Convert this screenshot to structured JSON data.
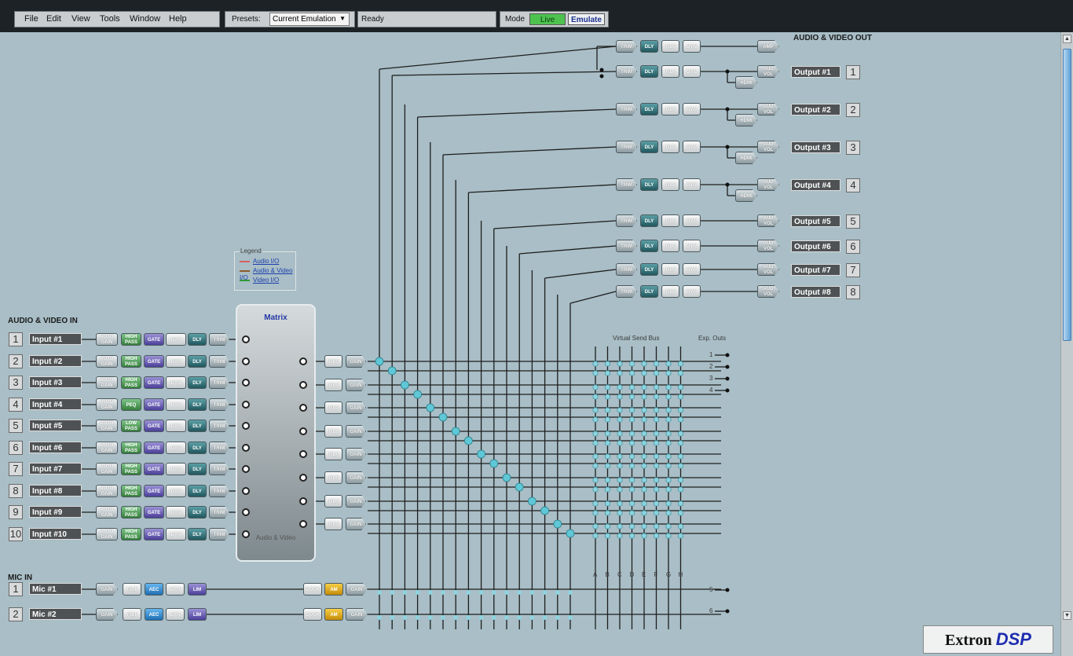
{
  "menu": [
    "File",
    "Edit",
    "View",
    "Tools",
    "Window",
    "Help"
  ],
  "presets": {
    "label": "Presets:",
    "value": "Current Emulation"
  },
  "status": "Ready",
  "mode": {
    "label": "Mode",
    "live": "Live",
    "emulate": "Emulate"
  },
  "sections": {
    "av_in": "AUDIO & VIDEO IN",
    "av_out": "AUDIO & VIDEO OUT",
    "mic_in": "MIC IN"
  },
  "legend": {
    "title": "Legend",
    "items": [
      "Audio I/O",
      "Audio & Video I/O",
      "Video I/O"
    ],
    "colors": [
      "#d86060",
      "#8a5a2a",
      "#2f9a3c"
    ]
  },
  "matrix": {
    "title": "Matrix",
    "subtitle": "Audio & Video"
  },
  "inputs": [
    {
      "num": "1",
      "name": "Input #1",
      "chain": [
        "AUTO GAIN",
        "HIGH PASS",
        "GATE",
        "DYN",
        "DLY",
        "TRIM"
      ]
    },
    {
      "num": "2",
      "name": "Input #2",
      "chain": [
        "AUTO GAIN",
        "HIGH PASS",
        "GATE",
        "DYN",
        "DLY",
        "TRIM"
      ]
    },
    {
      "num": "3",
      "name": "Input #3",
      "chain": [
        "AUTO GAIN",
        "HIGH PASS",
        "GATE",
        "DYN",
        "DLY",
        "TRIM"
      ]
    },
    {
      "num": "4",
      "name": "Input #4",
      "chain": [
        "AUTO GAIN",
        "PEQ",
        "GATE",
        "DYN",
        "DLY",
        "TRIM"
      ]
    },
    {
      "num": "5",
      "name": "Input #5",
      "chain": [
        "AUTO GAIN",
        "LOW PASS",
        "GATE",
        "DYN",
        "DLY",
        "TRIM"
      ]
    },
    {
      "num": "6",
      "name": "Input #6",
      "chain": [
        "AUTO GAIN",
        "HIGH PASS",
        "GATE",
        "DYN",
        "DLY",
        "TRIM"
      ]
    },
    {
      "num": "7",
      "name": "Input #7",
      "chain": [
        "AUTO GAIN",
        "HIGH PASS",
        "GATE",
        "DYN",
        "DLY",
        "TRIM"
      ]
    },
    {
      "num": "8",
      "name": "Input #8",
      "chain": [
        "AUTO GAIN",
        "HIGH PASS",
        "GATE",
        "DYN",
        "DLY",
        "TRIM"
      ]
    },
    {
      "num": "9",
      "name": "Input #9",
      "chain": [
        "AUTO GAIN",
        "HIGH PASS",
        "GATE",
        "DYN",
        "DLY",
        "TRIM"
      ]
    },
    {
      "num": "10",
      "name": "Input #10",
      "chain": [
        "AUTO GAIN",
        "HIGH PASS",
        "GATE",
        "DYN",
        "DLY",
        "TRIM"
      ]
    }
  ],
  "mics": [
    {
      "num": "1",
      "name": "Mic #1",
      "chain": [
        "GAIN",
        "FILT",
        "AEC",
        "DYN",
        "LIM"
      ],
      "post": [
        "DUCK",
        "AM",
        "GAIN"
      ]
    },
    {
      "num": "2",
      "name": "Mic #2",
      "chain": [
        "GAIN",
        "FILT",
        "AEC",
        "DYN",
        "LIM"
      ],
      "post": [
        "DUCK",
        "AM",
        "GAIN"
      ]
    }
  ],
  "matrix_out_blocks": [
    "FILT",
    "GAIN"
  ],
  "outputs": [
    {
      "num": "",
      "name": "",
      "chain": [
        "TRIM",
        "DLY",
        "FILT",
        "DYN"
      ],
      "end": "AMP"
    },
    {
      "num": "1",
      "name": "Output #1",
      "chain": [
        "TRIM",
        "DLY",
        "FILT",
        "DYN"
      ],
      "end": "AUD VOL",
      "hdmi": "HDMI"
    },
    {
      "num": "2",
      "name": "Output #2",
      "chain": [
        "TRIM",
        "DLY",
        "FILT",
        "DYN"
      ],
      "end": "AUD VOL",
      "hdmi": "HDMI"
    },
    {
      "num": "3",
      "name": "Output #3",
      "chain": [
        "TRIM",
        "DLY",
        "FILT",
        "DYN"
      ],
      "end": "AUD VOL",
      "hdmi": "HDMI"
    },
    {
      "num": "4",
      "name": "Output #4",
      "chain": [
        "TRIM",
        "DLY",
        "FILT",
        "DYN"
      ],
      "end": "AUD VOL",
      "hdmi": "HDMI"
    },
    {
      "num": "5",
      "name": "Output #5",
      "chain": [
        "TRIM",
        "DLY",
        "FILT",
        "DYN"
      ],
      "end": "AUD VOL"
    },
    {
      "num": "6",
      "name": "Output #6",
      "chain": [
        "TRIM",
        "DLY",
        "FILT",
        "DYN"
      ],
      "end": "AUD VOL"
    },
    {
      "num": "7",
      "name": "Output #7",
      "chain": [
        "TRIM",
        "DLY",
        "FILT",
        "DYN"
      ],
      "end": "AUD VOL"
    },
    {
      "num": "8",
      "name": "Output #8",
      "chain": [
        "TRIM",
        "DLY",
        "FILT",
        "DYN"
      ],
      "end": "AUD VOL"
    }
  ],
  "virtual_send_bus": {
    "title": "Virtual Send Bus",
    "letters": [
      "A",
      "B",
      "C",
      "D",
      "E",
      "F",
      "G",
      "H"
    ]
  },
  "exp_outs": {
    "title": "Exp. Outs",
    "nums": [
      "1",
      "2",
      "3",
      "4",
      "5",
      "6"
    ]
  },
  "logo": {
    "brand": "Extron",
    "product": "DSP"
  },
  "colors": {
    "background": "#a9bec6",
    "toolbar": "#1d2226",
    "live": "#4dc24f",
    "wire": "#1e1e1e",
    "node": "#5fc7d6"
  }
}
